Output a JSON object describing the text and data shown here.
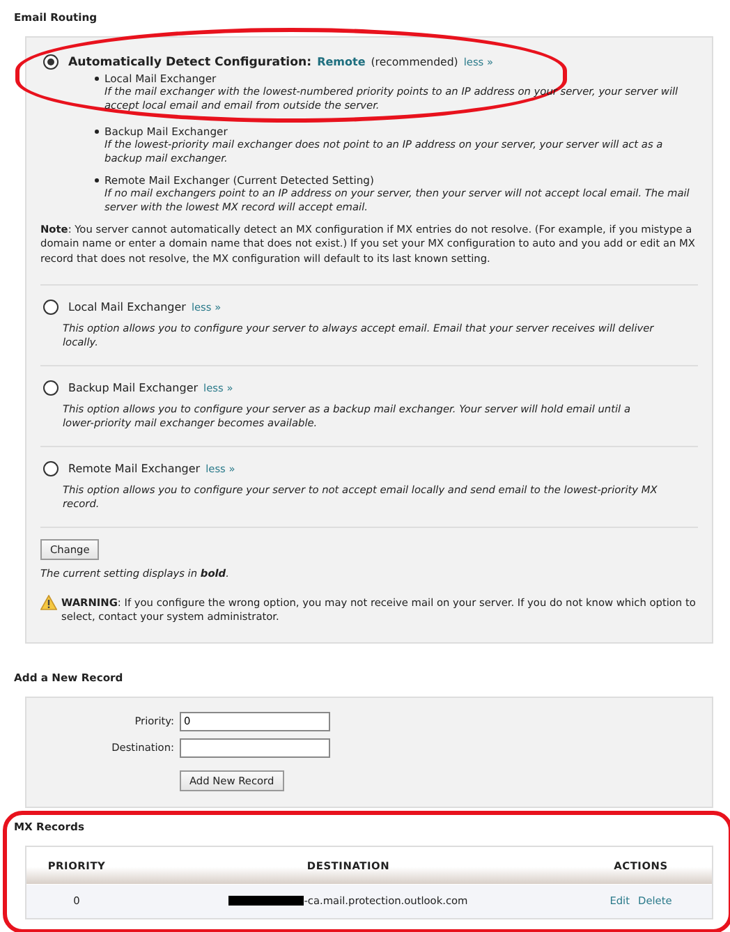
{
  "routing": {
    "title": "Email Routing",
    "options": [
      {
        "kind": "auto",
        "selected": true,
        "label": "Automatically Detect Configuration:",
        "detected": "Remote",
        "note": "(recommended)",
        "toggle": "less »",
        "items": [
          {
            "name": "Local Mail Exchanger",
            "description": "If the mail exchanger with the lowest-numbered priority points to an IP address on your server, your server will accept local email and email from outside the server."
          },
          {
            "name": "Backup Mail Exchanger",
            "description": "If the lowest-priority mail exchanger does not point to an IP address on your server, your server will act as a backup mail exchanger."
          },
          {
            "name": "Remote Mail Exchanger (Current Detected Setting)",
            "description": "If no mail exchangers point to an IP address on your server, then your server will not accept local email. The mail server with the lowest MX record will accept email."
          }
        ],
        "footnote": "**Note**: You server cannot automatically detect an MX configuration if MX entries do not resolve. (For example, if you mistype a domain name or enter a domain name that does not exist.) If you set your MX configuration to auto and you add or edit an MX record that does not resolve, the MX configuration will default to its last known setting."
      },
      {
        "kind": "plain",
        "selected": false,
        "label": "Local Mail Exchanger",
        "toggle": "less »",
        "description": "This option allows you to configure your server to always accept email. Email that your server receives will deliver locally."
      },
      {
        "kind": "plain",
        "selected": false,
        "label": "Backup Mail Exchanger",
        "toggle": "less »",
        "description": "This option allows you to configure your server as a backup mail exchanger. Your server will hold email until a lower-priority mail exchanger becomes available."
      },
      {
        "kind": "plain",
        "selected": false,
        "label": "Remote Mail Exchanger",
        "toggle": "less »",
        "description": "This option allows you to configure your server to not accept email locally and send email to the lowest-priority MX record."
      }
    ],
    "button": "Change",
    "hint": "The current setting displays in **bold**.",
    "warning": "**WARNING**: If you configure the wrong option, you may not receive mail on your server. If you do not know which option to select, contact your system administrator."
  },
  "add_record": {
    "title": "Add a New Record",
    "fields": [
      {
        "label": "Priority:",
        "value": "0"
      },
      {
        "label": "Destination:"
      }
    ],
    "button": "Add New Record"
  },
  "mx_records": {
    "title": "MX Records",
    "columns": [
      "PRIORITY",
      "DESTINATION",
      "ACTIONS"
    ],
    "rows": [
      {
        "priority": "0",
        "destination": "-ca.mail.protection.outlook.com",
        "redacted": true,
        "actions": [
          "Edit",
          "Delete"
        ]
      }
    ]
  }
}
